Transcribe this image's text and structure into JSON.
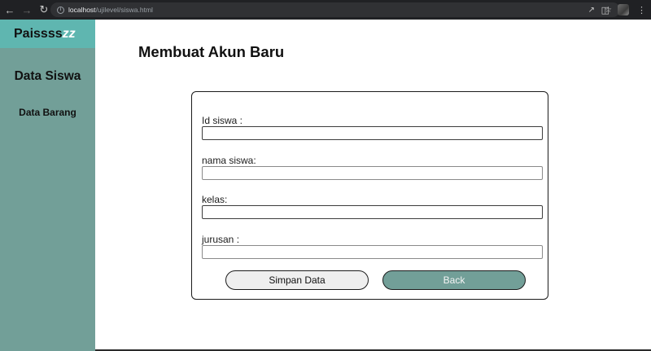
{
  "browser": {
    "url_host": "localhost",
    "url_path": "/ujilevel/siswa.html"
  },
  "sidebar": {
    "brand_main": "Paissss",
    "brand_accent": "zz",
    "items": [
      {
        "label": "Data Siswa"
      },
      {
        "label": "Data Barang"
      }
    ]
  },
  "main": {
    "title": "Membuat Akun Baru"
  },
  "form": {
    "fields": [
      {
        "label": "Id siswa :",
        "value": ""
      },
      {
        "label": "nama siswa:",
        "value": ""
      },
      {
        "label": "kelas:",
        "value": ""
      },
      {
        "label": "jurusan :",
        "value": ""
      }
    ],
    "save_label": "Simpan Data",
    "back_label": "Back"
  },
  "colors": {
    "sidebar": "#729f98",
    "brand_bar": "#5fb6b0",
    "back_button": "#729f98",
    "save_button": "#efefef"
  }
}
